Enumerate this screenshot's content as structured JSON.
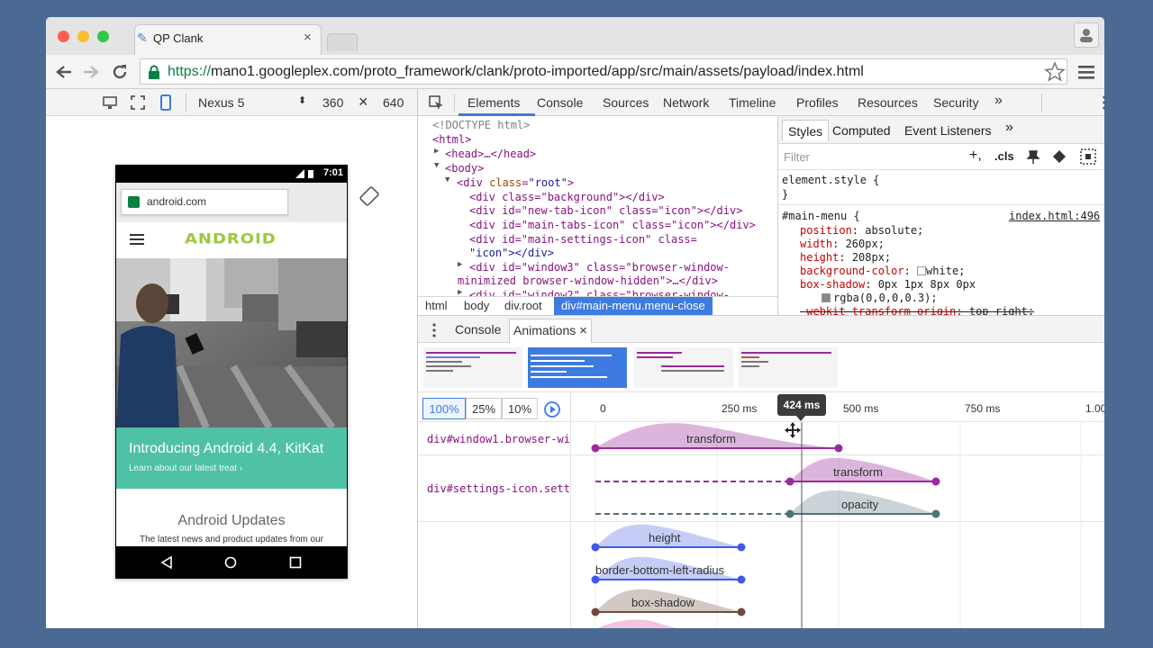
{
  "browser": {
    "tab_title": "QP Clank",
    "url_scheme": "https://",
    "url_rest": "mano1.googleplex.com/proto_framework/clank/proto-imported/app/src/main/assets/payload/index.html",
    "back_icon": "back-arrow-icon",
    "forward_icon": "forward-arrow-icon",
    "reload_icon": "reload-icon",
    "star_icon": "star-icon",
    "menu_icon": "hamburger-icon",
    "colors": {
      "close": "#fc5f57",
      "minimize": "#fdbc2e",
      "zoom": "#33c748",
      "secure": "#0b8043"
    }
  },
  "device_toolbar": {
    "device": "Nexus 5",
    "width": "360",
    "times": "×",
    "height": "640"
  },
  "phone": {
    "time": "7:01",
    "url": "android.com",
    "logo": "ANDROID",
    "banner_title": "Introducing Android 4.4, KitKat",
    "banner_link": "Learn about our latest treat ›",
    "updates_title": "Android Updates",
    "updates_text": "The latest news and product updates from our",
    "colors": {
      "banner": "#4fc1a5",
      "logo": "#9fc63b"
    }
  },
  "devtools": {
    "tabs": [
      "Elements",
      "Console",
      "Sources",
      "Network",
      "Timeline",
      "Profiles",
      "Resources",
      "Security"
    ],
    "more": "»",
    "active_tab": "Elements",
    "breadcrumbs": [
      "html",
      "body",
      "div.root",
      "div#main-menu.menu-close"
    ],
    "styles_tabs": [
      "Styles",
      "Computed",
      "Event Listeners"
    ],
    "filter_placeholder": "Filter",
    "cls_label": ".cls",
    "plus_label": "+,",
    "element_style": "element.style {",
    "close_brace": "}",
    "rule_selector": "#main-menu {",
    "rule_source": "index.html:496",
    "props": [
      {
        "k": "position",
        "v": "absolute;"
      },
      {
        "k": "width",
        "v": "260px;"
      },
      {
        "k": "height",
        "v": "208px;"
      },
      {
        "k": "background-color",
        "v": "white;"
      },
      {
        "k": "box-shadow",
        "v": "0px 1px 8px 0px"
      },
      {
        "k": "",
        "v": "rgba(0,0,0,0.3);"
      },
      {
        "k": "-webkit-transform-origin",
        "v": "top right;"
      }
    ]
  },
  "dom": {
    "doctype": "<!DOCTYPE html>",
    "html_open": "<html>",
    "head": "<head>…</head>",
    "body_open": "<body>",
    "div_open": "<div ",
    "class_attr": "class",
    "root_val": "\"root\"",
    "gt": ">",
    "bg_line": "<div class=\"background\"></div>",
    "newtab_line": "<div id=\"new-tab-icon\" class=\"icon\"></div>",
    "maintabs_line": "<div id=\"main-tabs-icon\" class=\"icon\"></div>",
    "settings_line1": "<div id=\"main-settings-icon\" class=",
    "settings_line2": "\"icon\"></div>",
    "window3_line1": "<div id=\"window3\" class=\"browser-window-",
    "window3_line2": "minimized browser-window-hidden\">…</div>",
    "window2_line": "<div id=\"window2\" class=\"browser-window-"
  },
  "drawer": {
    "tabs": [
      "Console",
      "Animations"
    ],
    "close": "×",
    "speeds": [
      "100%",
      "25%",
      "10%"
    ],
    "ticks": [
      "0",
      "250 ms",
      "500 ms",
      "750 ms",
      "1.00"
    ],
    "scrubber": "424 ms",
    "rows": [
      {
        "label": "div#window1.browser-wi"
      },
      {
        "label": "div#settings-icon.sett"
      }
    ],
    "animations": [
      "transform",
      "transform",
      "opacity",
      "height",
      "border-bottom-left-radius",
      "box-shadow"
    ],
    "colors": {
      "purple": "#9a2a9e",
      "gray": "#50707a",
      "blue": "#4059e6",
      "brown": "#6e4a3c",
      "selected": "#3d7be0"
    }
  }
}
